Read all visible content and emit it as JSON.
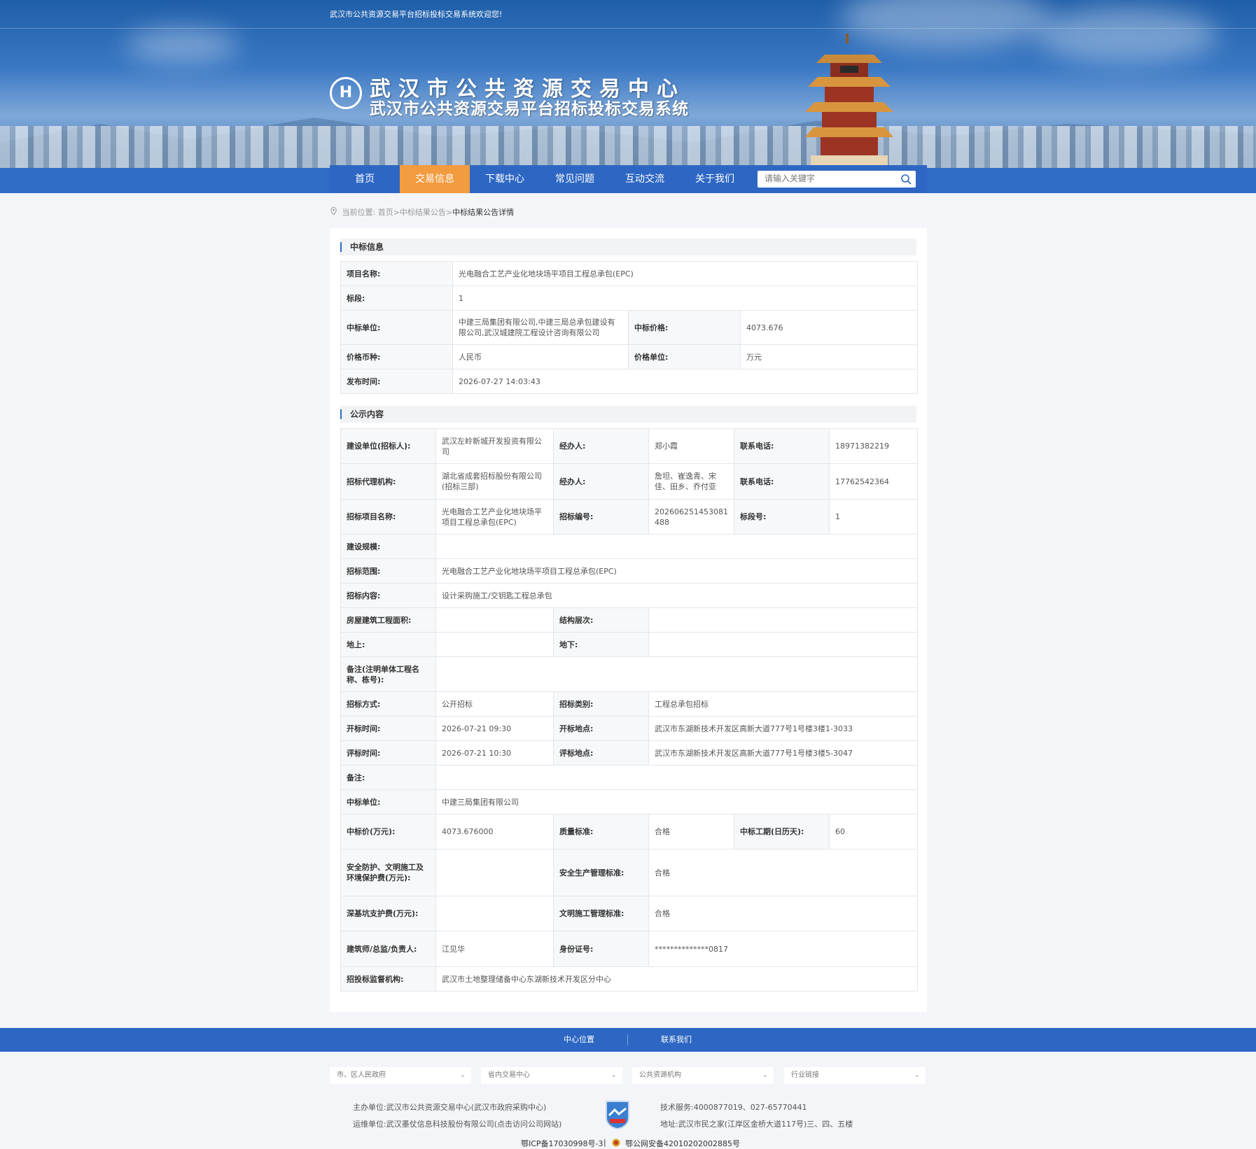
{
  "header": {
    "welcome": "武汉市公共资源交易平台招标投标交易系统欢迎您!",
    "title_main": "武汉市公共资源交易中心",
    "title_sub": "武汉市公共资源交易平台招标投标交易系统"
  },
  "nav": {
    "items": [
      "首页",
      "交易信息",
      "下载中心",
      "常见问题",
      "互动交流",
      "关于我们"
    ],
    "active": "交易信息",
    "search_placeholder": "请输入关键字"
  },
  "breadcrumb": {
    "prefix": "当前位置:",
    "path": "首页>中标结果公告>",
    "current": "中标结果公告详情"
  },
  "award_info": {
    "section_title": "中标信息",
    "project_name_label": "项目名称:",
    "project_name": "光电融合工艺产业化地块场平项目工程总承包(EPC)",
    "section_label": "标段:",
    "section": "1",
    "winner_label": "中标单位:",
    "winner": "中建三局集团有限公司,中建三局总承包建设有限公司,武汉城建院工程设计咨询有限公司",
    "price_label": "中标价格:",
    "price": "4073.676",
    "currency_label": "价格币种:",
    "currency": "人民币",
    "price_unit_label": "价格单位:",
    "price_unit": "万元",
    "publish_time_label": "发布时间:",
    "publish_time": "2026-07-27 14:03:43"
  },
  "notice": {
    "section_title": "公示内容",
    "owner_label": "建设单位(招标人):",
    "owner": "武汉左岭新城开发投资有限公司",
    "handler_label": "经办人:",
    "owner_handler": "郑小霞",
    "phone_label": "联系电话:",
    "owner_phone": "18971382219",
    "agency_label": "招标代理机构:",
    "agency": "湖北省成套招标股份有限公司(招标三部)",
    "agency_handler": "詹坦、崔逸青、宋佳、田乡、乔付亚",
    "agency_phone": "17762542364",
    "bid_project_label": "招标项目名称:",
    "bid_project": "光电融合工艺产业化地块场平项目工程总承包(EPC)",
    "bid_no_label": "招标编号:",
    "bid_no": "202606251453081488",
    "lot_no_label": "标段号:",
    "lot_no": "1",
    "scale_label": "建设规模:",
    "scale": "",
    "scope_label": "招标范围:",
    "scope": "光电融合工艺产业化地块场平项目工程总承包(EPC)",
    "content_label": "招标内容:",
    "content": "设计采购施工/交钥匙工程总承包",
    "area_label": "房屋建筑工程面积:",
    "area": "",
    "floors_label": "结构层次:",
    "floors": "",
    "above_label": "地上:",
    "above": "",
    "below_label": "地下:",
    "below": "",
    "remark_unit_label": "备注(注明单体工程名称、栋号):",
    "remark_unit": "",
    "method_label": "招标方式:",
    "method": "公开招标",
    "category_label": "招标类别:",
    "category": "工程总承包招标",
    "open_time_label": "开标时间:",
    "open_time": "2026-07-21 09:30",
    "open_place_label": "开标地点:",
    "open_place": "武汉市东湖新技术开发区高新大道777号1号楼3楼1-3033",
    "eval_time_label": "评标时间:",
    "eval_time": "2026-07-21 10:30",
    "eval_place_label": "评标地点:",
    "eval_place": "武汉市东湖新技术开发区高新大道777号1号楼3楼5-3047",
    "remark_label": "备注:",
    "remark": "",
    "winner_label": "中标单位:",
    "winner": "中建三局集团有限公司",
    "win_price_label": "中标价(万元):",
    "win_price": "4073.676000",
    "quality_label": "质量标准:",
    "quality": "合格",
    "period_label": "中标工期(日历天):",
    "period": "60",
    "safety_fee_label": "安全防护、文明施工及环境保护费(万元):",
    "safety_fee": "",
    "safety_std_label": "安全生产管理标准:",
    "safety_std": "合格",
    "pit_fee_label": "深基坑支护费(万元):",
    "pit_fee": "",
    "civil_std_label": "文明施工管理标准:",
    "civil_std": "合格",
    "manager_label": "建筑师/总监/负责人:",
    "manager": "江见华",
    "id_label": "身份证号:",
    "id": "**************0817",
    "supervisor_label": "招投标监督机构:",
    "supervisor": "武汉市土地整理储备中心东湖新技术开发区分中心"
  },
  "footer": {
    "links": [
      "中心位置",
      "联系我们"
    ],
    "selects": [
      "市、区人民政府",
      "省内交易中心",
      "公共资源机构",
      "行业链接"
    ],
    "host": "主办单位:武汉市公共资源交易中心(武汉市政府采购中心)",
    "operator": "运维单位:武汉墨仗信息科技股份有限公司(点击访问公司网站)",
    "tech": "技术服务:4000877019、027-65770441",
    "address": "地址:武汉市民之家(江岸区金桥大道117号)三、四、五楼",
    "icp": "鄂ICP备17030998号-3",
    "police": "鄂公网安备42010202002885号"
  },
  "colors": {
    "primary": "#2d67c3",
    "active_nav": "#f39b3f"
  }
}
